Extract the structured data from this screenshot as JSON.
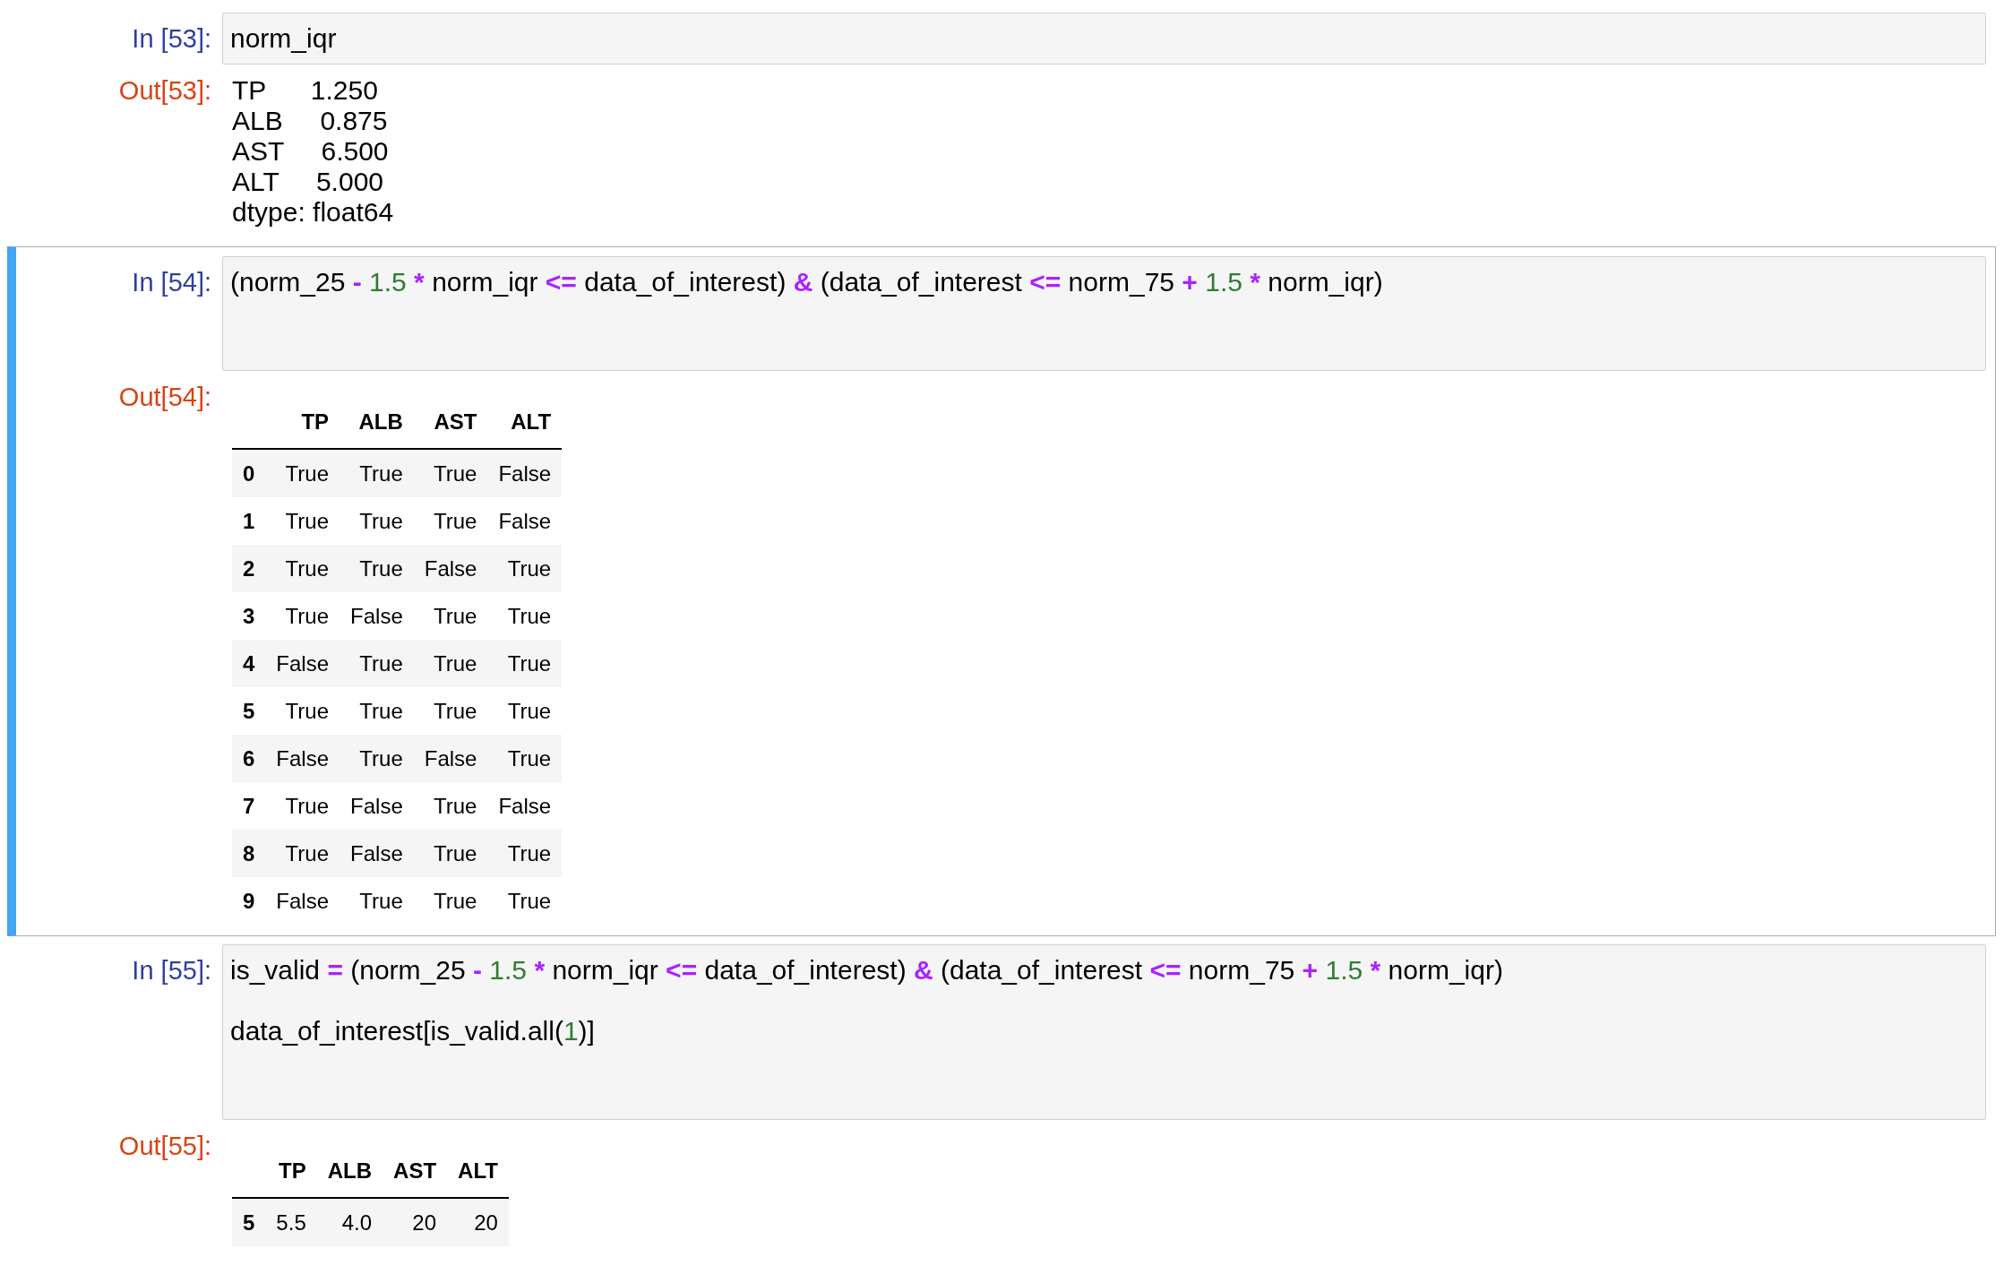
{
  "cells": [
    {
      "selected": false,
      "in_prompt": "In [53]:",
      "code": [
        [
          {
            "kind": "name",
            "text": "norm_iqr"
          }
        ]
      ],
      "output": {
        "prompt": "Out[53]:",
        "kind": "text",
        "lines": [
          "TP      1.250",
          "ALB     0.875",
          "AST     6.500",
          "ALT     5.000",
          "dtype: float64"
        ]
      }
    },
    {
      "selected": true,
      "in_prompt": "In [54]:",
      "code": [
        [
          {
            "kind": "name",
            "text": "(norm_25 "
          },
          {
            "kind": "op",
            "text": "- "
          },
          {
            "kind": "num",
            "text": "1.5"
          },
          {
            "kind": "op",
            "text": " *"
          },
          {
            "kind": "name",
            "text": " norm_iqr "
          },
          {
            "kind": "op",
            "text": "<="
          },
          {
            "kind": "name",
            "text": " data_of_interest) "
          },
          {
            "kind": "op",
            "text": "&"
          },
          {
            "kind": "name",
            "text": " (data_of_interest "
          },
          {
            "kind": "op",
            "text": "<="
          },
          {
            "kind": "name",
            "text": " norm_75 "
          },
          {
            "kind": "op",
            "text": "+ "
          },
          {
            "kind": "num",
            "text": "1.5"
          },
          {
            "kind": "op",
            "text": " *"
          },
          {
            "kind": "name",
            "text": " norm_iqr)"
          }
        ]
      ],
      "output": {
        "prompt": "Out[54]:",
        "kind": "table",
        "columns": [
          "TP",
          "ALB",
          "AST",
          "ALT"
        ],
        "rows": [
          {
            "index": "0",
            "cells": [
              "True",
              "True",
              "True",
              "False"
            ]
          },
          {
            "index": "1",
            "cells": [
              "True",
              "True",
              "True",
              "False"
            ]
          },
          {
            "index": "2",
            "cells": [
              "True",
              "True",
              "False",
              "True"
            ]
          },
          {
            "index": "3",
            "cells": [
              "True",
              "False",
              "True",
              "True"
            ]
          },
          {
            "index": "4",
            "cells": [
              "False",
              "True",
              "True",
              "True"
            ]
          },
          {
            "index": "5",
            "cells": [
              "True",
              "True",
              "True",
              "True"
            ]
          },
          {
            "index": "6",
            "cells": [
              "False",
              "True",
              "False",
              "True"
            ]
          },
          {
            "index": "7",
            "cells": [
              "True",
              "False",
              "True",
              "False"
            ]
          },
          {
            "index": "8",
            "cells": [
              "True",
              "False",
              "True",
              "True"
            ]
          },
          {
            "index": "9",
            "cells": [
              "False",
              "True",
              "True",
              "True"
            ]
          }
        ]
      }
    },
    {
      "selected": false,
      "in_prompt": "In [55]:",
      "code": [
        [
          {
            "kind": "name",
            "text": "is_valid "
          },
          {
            "kind": "op",
            "text": "="
          },
          {
            "kind": "name",
            "text": " (norm_25 "
          },
          {
            "kind": "op",
            "text": "- "
          },
          {
            "kind": "num",
            "text": "1.5"
          },
          {
            "kind": "op",
            "text": " *"
          },
          {
            "kind": "name",
            "text": " norm_iqr "
          },
          {
            "kind": "op",
            "text": "<="
          },
          {
            "kind": "name",
            "text": " data_of_interest) "
          },
          {
            "kind": "op",
            "text": "&"
          },
          {
            "kind": "name",
            "text": " (data_of_interest "
          },
          {
            "kind": "op",
            "text": "<="
          },
          {
            "kind": "name",
            "text": " norm_75 "
          },
          {
            "kind": "op",
            "text": "+ "
          },
          {
            "kind": "num",
            "text": "1.5"
          },
          {
            "kind": "op",
            "text": " *"
          },
          {
            "kind": "name",
            "text": " norm_iqr)"
          }
        ],
        [
          {
            "kind": "name",
            "text": "data_of_interest[is_valid.all("
          },
          {
            "kind": "num",
            "text": "1"
          },
          {
            "kind": "name",
            "text": ")]"
          }
        ]
      ],
      "output": {
        "prompt": "Out[55]:",
        "kind": "table",
        "columns": [
          "TP",
          "ALB",
          "AST",
          "ALT"
        ],
        "rows": [
          {
            "index": "5",
            "cells": [
              "5.5",
              "4.0",
              "20",
              "20"
            ]
          }
        ]
      }
    }
  ]
}
